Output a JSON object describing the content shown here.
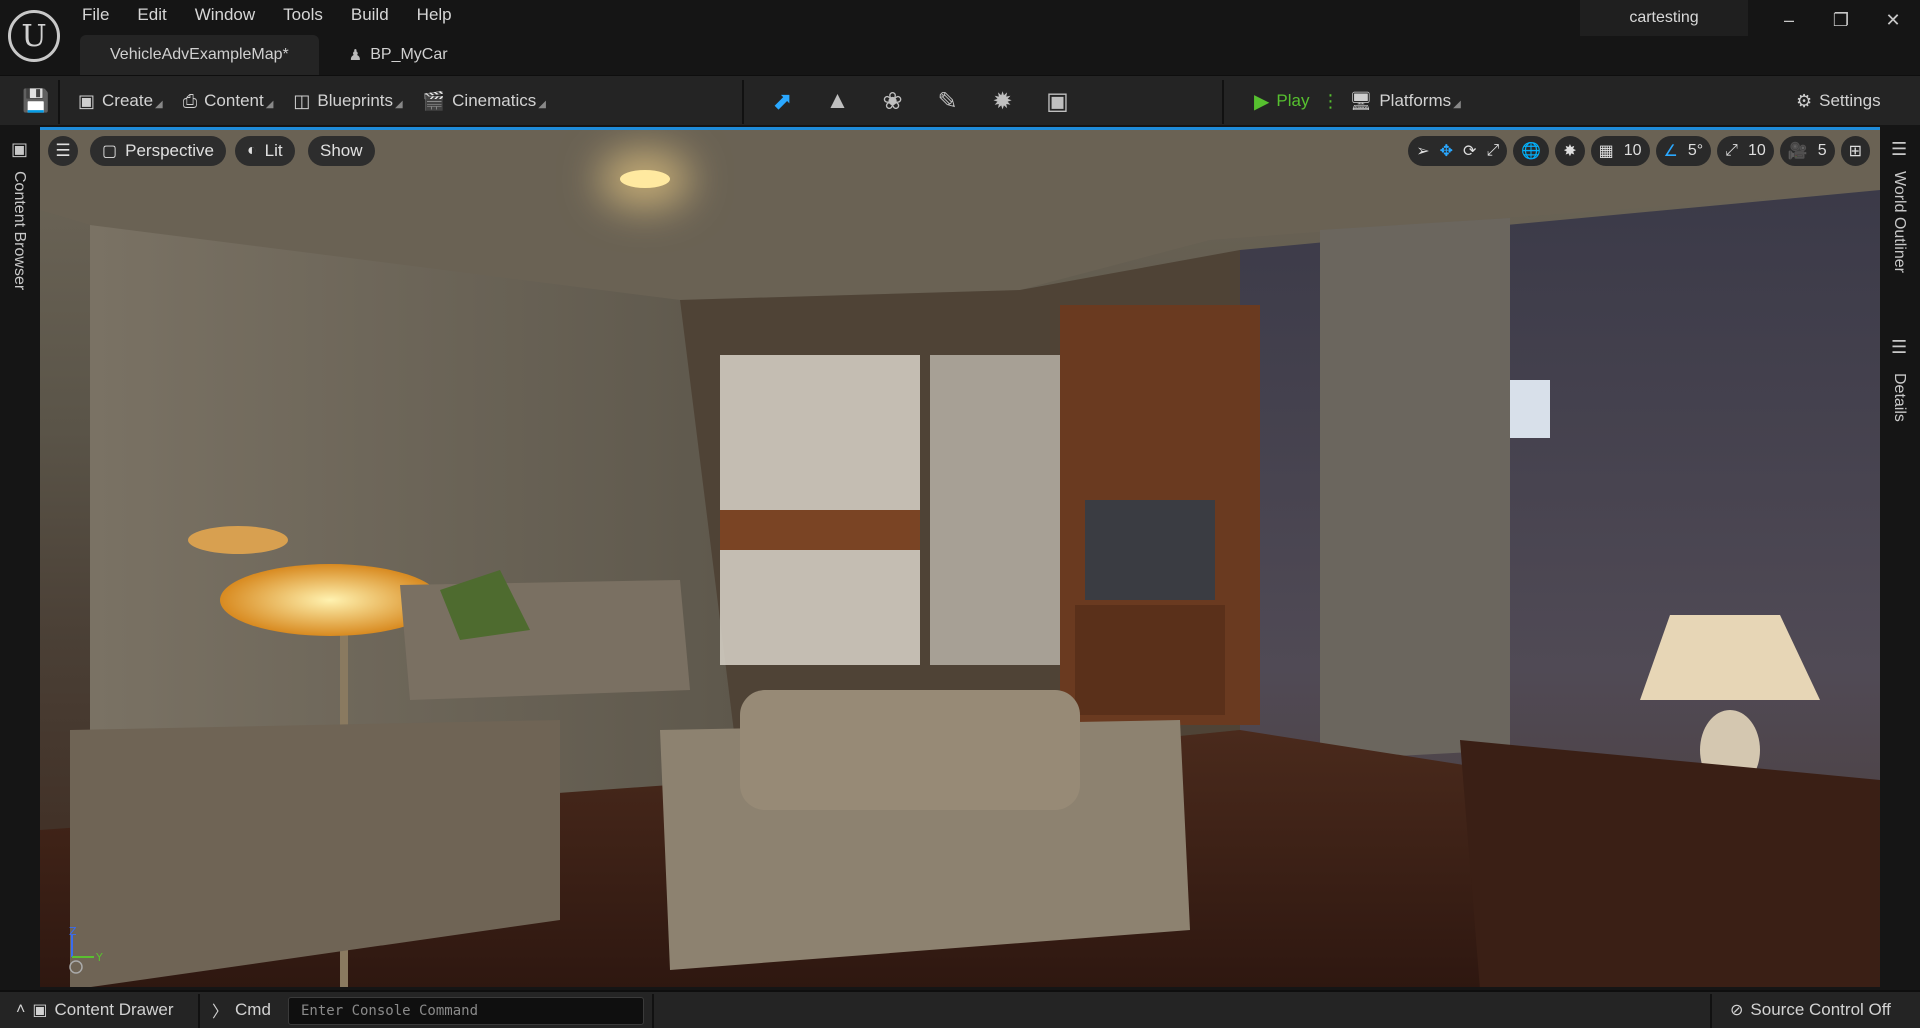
{
  "menu": [
    "File",
    "Edit",
    "Window",
    "Tools",
    "Build",
    "Help"
  ],
  "tabs": [
    {
      "label": "VehicleAdvExampleMap*",
      "active": true
    },
    {
      "label": "BP_MyCar",
      "active": false
    }
  ],
  "project_name": "cartesting",
  "toolbar": {
    "create": "Create",
    "content": "Content",
    "blueprints": "Blueprints",
    "cinematics": "Cinematics",
    "play": "Play",
    "platforms": "Platforms",
    "settings": "Settings"
  },
  "modes": [
    "select-mode",
    "landscape-mode",
    "foliage-mode",
    "mesh-paint-mode",
    "fracture-mode",
    "modeling-mode"
  ],
  "side_tabs": {
    "content_browser": "Content Browser",
    "world_outliner": "World Outliner",
    "details": "Details"
  },
  "viewport": {
    "perspective": "Perspective",
    "lit": "Lit",
    "show": "Show",
    "grid_snap": "10",
    "rotation_snap": "5°",
    "scale_snap": "10",
    "camera_speed": "5",
    "axis_z": "Z",
    "axis_y": "Y"
  },
  "statusbar": {
    "content_drawer": "Content Drawer",
    "cmd": "Cmd",
    "console_placeholder": "Enter Console Command",
    "source_control": "Source Control Off"
  },
  "colors": {
    "accent_blue": "#2aa8ff",
    "play_green": "#56c02f",
    "background": "#151515",
    "toolbar": "#242424"
  }
}
